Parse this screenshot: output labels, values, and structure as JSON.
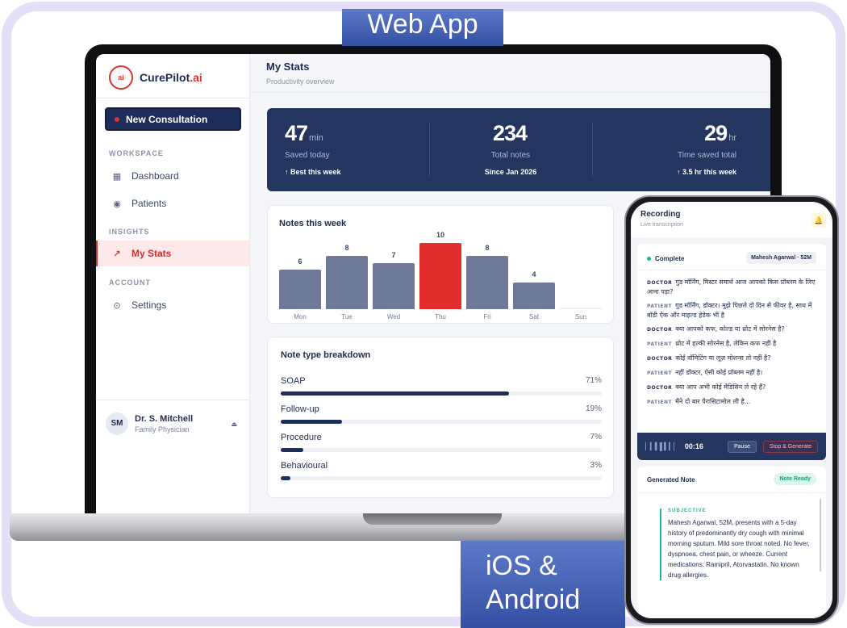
{
  "badges": {
    "web": "Web App",
    "mobile_line1": "iOS &",
    "mobile_line2": "Android"
  },
  "web": {
    "brand": {
      "logo": "ai",
      "name": "CurePilot",
      "suffix": ".ai"
    },
    "new_consultation": "New Consultation",
    "sections": {
      "workspace": "WORKSPACE",
      "insights": "INSIGHTS",
      "account": "ACCOUNT"
    },
    "nav": {
      "dashboard": "Dashboard",
      "patients": "Patients",
      "my_stats": "My Stats",
      "settings": "Settings"
    },
    "user": {
      "initials": "SM",
      "name": "Dr. S. Mitchell",
      "role": "Family Physician"
    },
    "header": {
      "title": "My Stats",
      "subtitle": "Productivity overview"
    },
    "stats": [
      {
        "value": "47",
        "unit": "min",
        "label": "Saved today",
        "note": "↑ Best this week"
      },
      {
        "value": "234",
        "unit": "",
        "label": "Total notes",
        "note": "Since Jan 2026"
      },
      {
        "value": "29",
        "unit": "hr",
        "label": "Time saved total",
        "note": "↑ 3.5 hr this week"
      }
    ],
    "notes_week": {
      "title": "Notes this week"
    },
    "breakdown": {
      "title": "Note type breakdown",
      "items": [
        {
          "label": "SOAP",
          "pct": "71%",
          "value": 0.71
        },
        {
          "label": "Follow-up",
          "pct": "19%",
          "value": 0.19
        },
        {
          "label": "Procedure",
          "pct": "7%",
          "value": 0.07
        },
        {
          "label": "Behavioural",
          "pct": "3%",
          "value": 0.03
        }
      ]
    },
    "colors": {
      "navy": "#243660",
      "accent": "#e22d2d",
      "bar": "#6f7a99"
    }
  },
  "chart_data": {
    "type": "bar",
    "title": "Notes this week",
    "categories": [
      "Mon",
      "Tue",
      "Wed",
      "Thu",
      "Fri",
      "Sat",
      "Sun"
    ],
    "values": [
      6,
      8,
      7,
      10,
      8,
      4,
      0
    ],
    "highlight": "Thu",
    "ylim": [
      0,
      10
    ]
  },
  "mobile": {
    "header": {
      "title": "Recording",
      "subtitle": "Live transcription"
    },
    "status": "Complete",
    "patient": "Mahesh Agarwal · 52M",
    "transcript": [
      {
        "speaker": "DOCTOR",
        "text": "गुड मॉर्निंग, मिस्टर समार्थ आज आपको किस प्रॉब्लम के लिए आना पड़ा?"
      },
      {
        "speaker": "PATIENT",
        "text": "गुड मॉर्निंग, डॉक्टर। मुझे पिछले दो दिन से फीवर है, साथ में बॉडी ऐक और माइल्ड हेडेक भी है"
      },
      {
        "speaker": "DOCTOR",
        "text": "क्या आपको कफ, कोल्ड या थ्रोट में सोरनेस है?"
      },
      {
        "speaker": "PATIENT",
        "text": "थ्रोट में हल्की सोरनेस है, लेकिन कफ नहीं है"
      },
      {
        "speaker": "DOCTOR",
        "text": "कोई वॉमिटिंग या लूज़ मोशन्स तो नहीं है?"
      },
      {
        "speaker": "PATIENT",
        "text": "नहीं डॉक्टर, ऐसी कोई प्रॉब्लम नहीं है।"
      },
      {
        "speaker": "DOCTOR",
        "text": "क्या आप अभी कोई मेडिसिन ले रहे हैं?"
      },
      {
        "speaker": "PATIENT",
        "text": "मैंने दो बार पैरासिटामोल ली है..."
      }
    ],
    "recording": {
      "timer": "00:16",
      "pause": "Pause",
      "stop": "Stop & Generate"
    },
    "note": {
      "title": "Generated Note",
      "badge": "Note Ready",
      "section": "SUBJECTIVE",
      "text": "Mahesh Agarwal, 52M, presents with a 5-day history of predominantly dry cough with minimal morning sputum. Mild sore throat noted. No fever, dyspnoea, chest pain, or wheeze. Current medications: Ramipril, Atorvastatin. No known drug allergies."
    }
  }
}
